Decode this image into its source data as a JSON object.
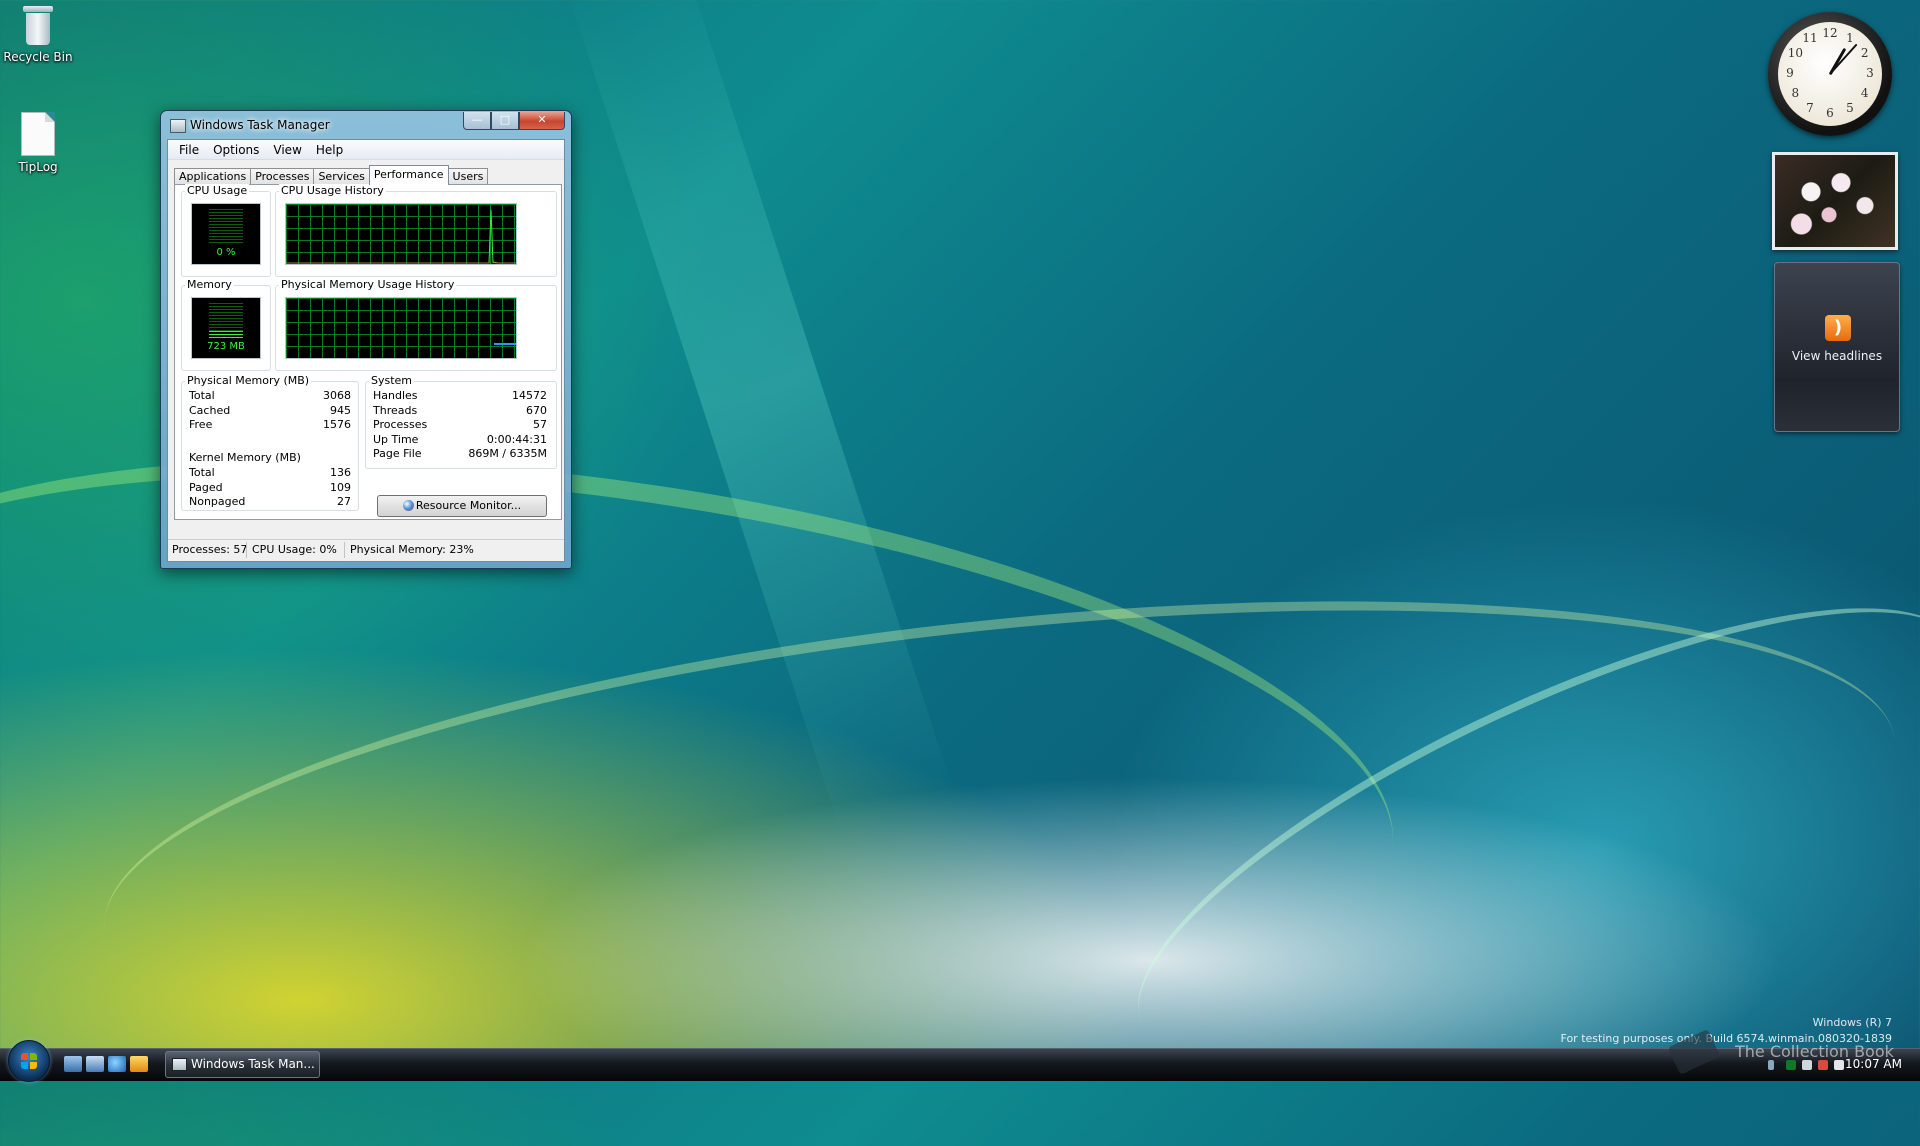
{
  "desktop": {
    "icons": [
      {
        "label": "Recycle Bin"
      },
      {
        "label": "TipLog"
      }
    ]
  },
  "gadgets": {
    "clock_numbers": [
      "12",
      "1",
      "2",
      "3",
      "4",
      "5",
      "6",
      "7",
      "8",
      "9",
      "10",
      "11"
    ],
    "feed_label": "View headlines"
  },
  "taskmanager": {
    "title": "Windows Task Manager",
    "menu": [
      "File",
      "Options",
      "View",
      "Help"
    ],
    "tabs": [
      "Applications",
      "Processes",
      "Services",
      "Performance",
      "Users"
    ],
    "active_tab": "Performance",
    "cpu_usage_label": "CPU Usage",
    "cpu_usage_value": "0 %",
    "cpu_usage_percent": 0,
    "cpu_history_label": "CPU Usage History",
    "memory_label": "Memory",
    "memory_value": "723 MB",
    "memory_fraction": 0.23,
    "memory_history_label": "Physical Memory Usage History",
    "physical_memory": {
      "title": "Physical Memory (MB)",
      "rows": [
        {
          "k": "Total",
          "v": "3068"
        },
        {
          "k": "Cached",
          "v": "945"
        },
        {
          "k": "Free",
          "v": "1576"
        }
      ]
    },
    "kernel_memory": {
      "title": "Kernel Memory (MB)",
      "rows": [
        {
          "k": "Total",
          "v": "136"
        },
        {
          "k": "Paged",
          "v": "109"
        },
        {
          "k": "Nonpaged",
          "v": "27"
        }
      ]
    },
    "system": {
      "title": "System",
      "rows": [
        {
          "k": "Handles",
          "v": "14572"
        },
        {
          "k": "Threads",
          "v": "670"
        },
        {
          "k": "Processes",
          "v": "57"
        },
        {
          "k": "Up Time",
          "v": "0:00:44:31"
        },
        {
          "k": "Page File",
          "v": "869M / 6335M"
        }
      ]
    },
    "resource_monitor_label": "Resource Monitor...",
    "status": {
      "processes": "Processes: 57",
      "cpu": "CPU Usage: 0%",
      "memory": "Physical Memory: 23%"
    }
  },
  "taskbar": {
    "task_label": "Windows Task Man...",
    "time": "10:07 AM"
  },
  "watermark": {
    "line1": "Windows (R) 7",
    "line2": "For testing purposes only. Build 6574.winmain.080320-1839",
    "overlay": "The Collection Book"
  },
  "colors": {
    "graph_green": "#39f23a",
    "grid_green": "#0a7a2a",
    "memory_line": "#3a8fff"
  }
}
